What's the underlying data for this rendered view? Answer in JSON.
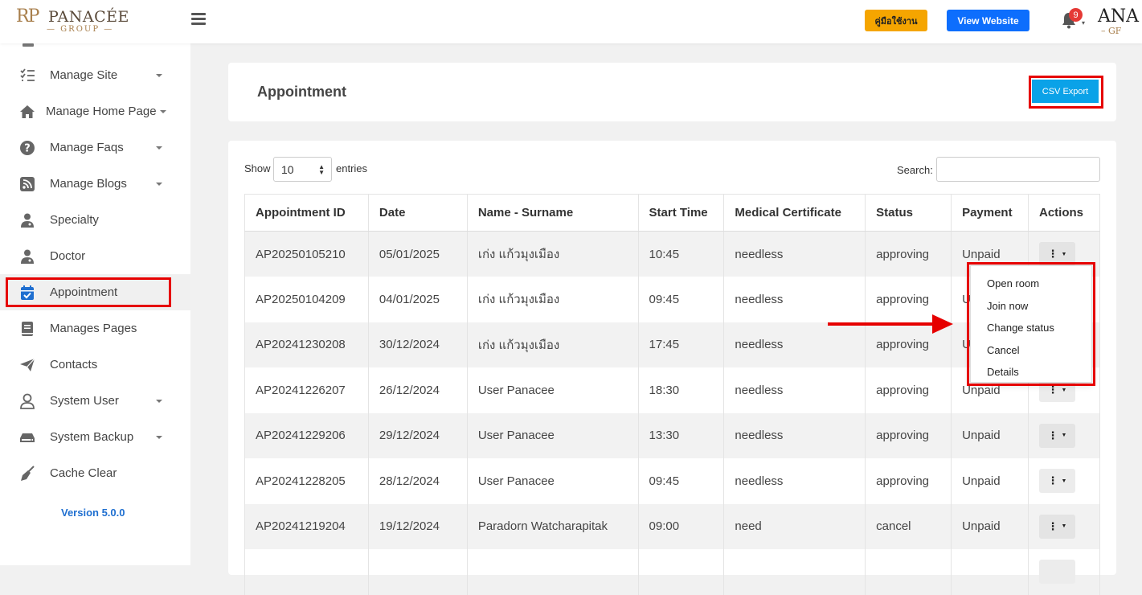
{
  "header": {
    "logo_mono": "RP",
    "logo_brand": "PANACÉE",
    "logo_group": "— GROUP —",
    "guide_button": "คู่มือใช้งาน",
    "website_button": "View Website",
    "notification_count": "9",
    "logo_right": "ANA",
    "logo_right_sub": "– GF"
  },
  "sidebar": {
    "items": [
      {
        "label": "Manage Site",
        "icon": "checklist-icon",
        "has_caret": true
      },
      {
        "label": "Manage Home Page",
        "icon": "home-icon",
        "has_caret": true
      },
      {
        "label": "Manage Faqs",
        "icon": "question-circle-icon",
        "has_caret": true
      },
      {
        "label": "Manage Blogs",
        "icon": "rss-icon",
        "has_caret": true
      },
      {
        "label": "Specialty",
        "icon": "doctor-icon",
        "has_caret": false
      },
      {
        "label": "Doctor",
        "icon": "doctor-icon",
        "has_caret": false
      },
      {
        "label": "Appointment",
        "icon": "calendar-check-icon",
        "has_caret": false,
        "active": true
      },
      {
        "label": "Manages Pages",
        "icon": "book-icon",
        "has_caret": false
      },
      {
        "label": "Contacts",
        "icon": "paper-plane-icon",
        "has_caret": false
      },
      {
        "label": "System User",
        "icon": "user-icon",
        "has_caret": true
      },
      {
        "label": "System Backup",
        "icon": "hdd-icon",
        "has_caret": true
      },
      {
        "label": "Cache Clear",
        "icon": "broom-icon",
        "has_caret": false
      }
    ],
    "version": "Version 5.0.0"
  },
  "page": {
    "title": "Appointment",
    "csv_button": "CSV Export"
  },
  "table_controls": {
    "show_label": "Show",
    "entries_value": "10",
    "entries_label": "entries",
    "search_label": "Search:"
  },
  "table": {
    "columns": [
      "Appointment ID",
      "Date",
      "Name - Surname",
      "Start Time",
      "Medical Certificate",
      "Status",
      "Payment",
      "Actions"
    ],
    "rows": [
      [
        "AP20250105210",
        "05/01/2025",
        "เก่ง แก้วมุงเมือง",
        "10:45",
        "needless",
        "approving",
        "Unpaid"
      ],
      [
        "AP20250104209",
        "04/01/2025",
        "เก่ง แก้วมุงเมือง",
        "09:45",
        "needless",
        "approving",
        "U"
      ],
      [
        "AP20241230208",
        "30/12/2024",
        "เก่ง แก้วมุงเมือง",
        "17:45",
        "needless",
        "approving",
        "U"
      ],
      [
        "AP20241226207",
        "26/12/2024",
        "User Panacee",
        "18:30",
        "needless",
        "approving",
        "Unpaid"
      ],
      [
        "AP20241229206",
        "29/12/2024",
        "User Panacee",
        "13:30",
        "needless",
        "approving",
        "Unpaid"
      ],
      [
        "AP20241228205",
        "28/12/2024",
        "User Panacee",
        "09:45",
        "needless",
        "approving",
        "Unpaid"
      ],
      [
        "AP20241219204",
        "19/12/2024",
        "Paradorn Watcharapitak",
        "09:00",
        "need",
        "cancel",
        "Unpaid"
      ],
      [
        "",
        "",
        "",
        "",
        "",
        "",
        ""
      ]
    ]
  },
  "dropdown": {
    "items": [
      "Open room",
      "Join now",
      "Change status",
      "Cancel",
      "Details"
    ]
  },
  "colors": {
    "highlight": "#e60000",
    "primary": "#0d6efd",
    "csv": "#0aa2e8",
    "guide": "#f5a500",
    "version": "#1f6fd0"
  }
}
